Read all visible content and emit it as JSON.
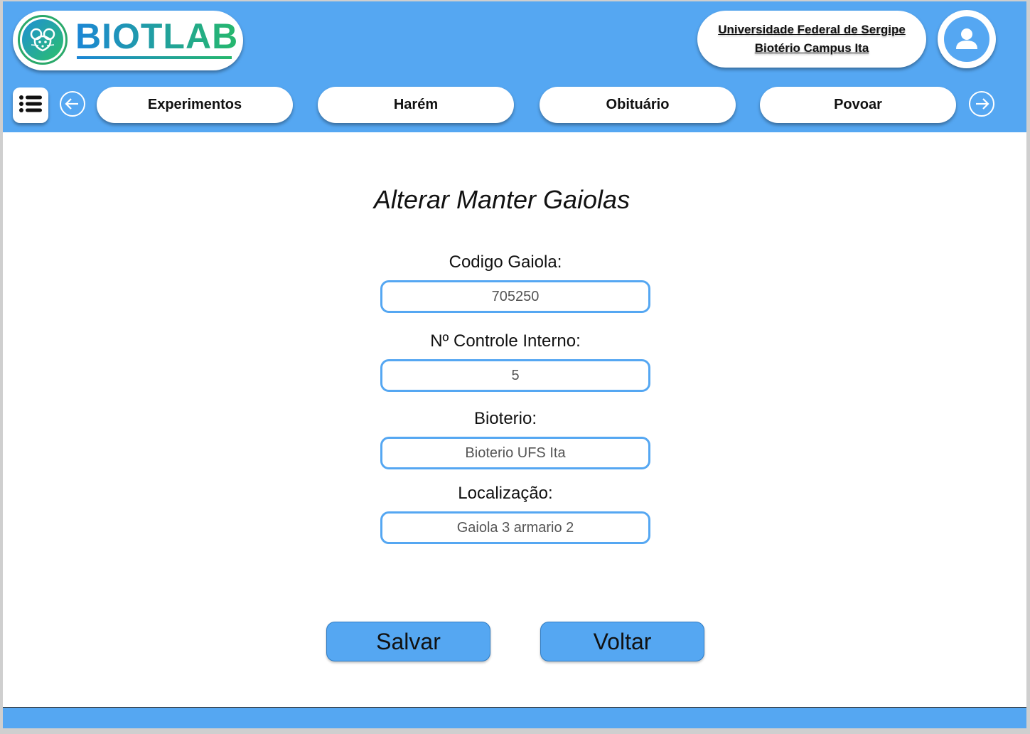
{
  "brand": {
    "name": "BIOTLAB",
    "logo_icon": "mouse-icon"
  },
  "institution": {
    "line1": "Universidade Federal de Sergipe",
    "line2": "Biotério Campus Ita"
  },
  "user": {
    "avatar_icon": "user-icon"
  },
  "nav": {
    "menu_icon": "list-icon",
    "prev_icon": "arrow-left-icon",
    "next_icon": "arrow-right-icon",
    "tabs": [
      {
        "label": "Experimentos"
      },
      {
        "label": "Harém"
      },
      {
        "label": "Obituário"
      },
      {
        "label": "Povoar"
      }
    ]
  },
  "page": {
    "title": "Alterar Manter Gaiolas"
  },
  "form": {
    "codigo_gaiola": {
      "label": "Codigo Gaiola:",
      "value": "705250"
    },
    "controle_interno": {
      "label": "Nº Controle Interno:",
      "value": "5"
    },
    "bioterio": {
      "label": "Bioterio:",
      "value": "Bioterio UFS Ita"
    },
    "localizacao": {
      "label": "Localização:",
      "value": "Gaiola 3 armario 2"
    }
  },
  "actions": {
    "save_label": "Salvar",
    "back_label": "Voltar"
  },
  "colors": {
    "primary": "#55a7f2",
    "brand_blue": "#1c86d6",
    "brand_green": "#26b86c"
  }
}
